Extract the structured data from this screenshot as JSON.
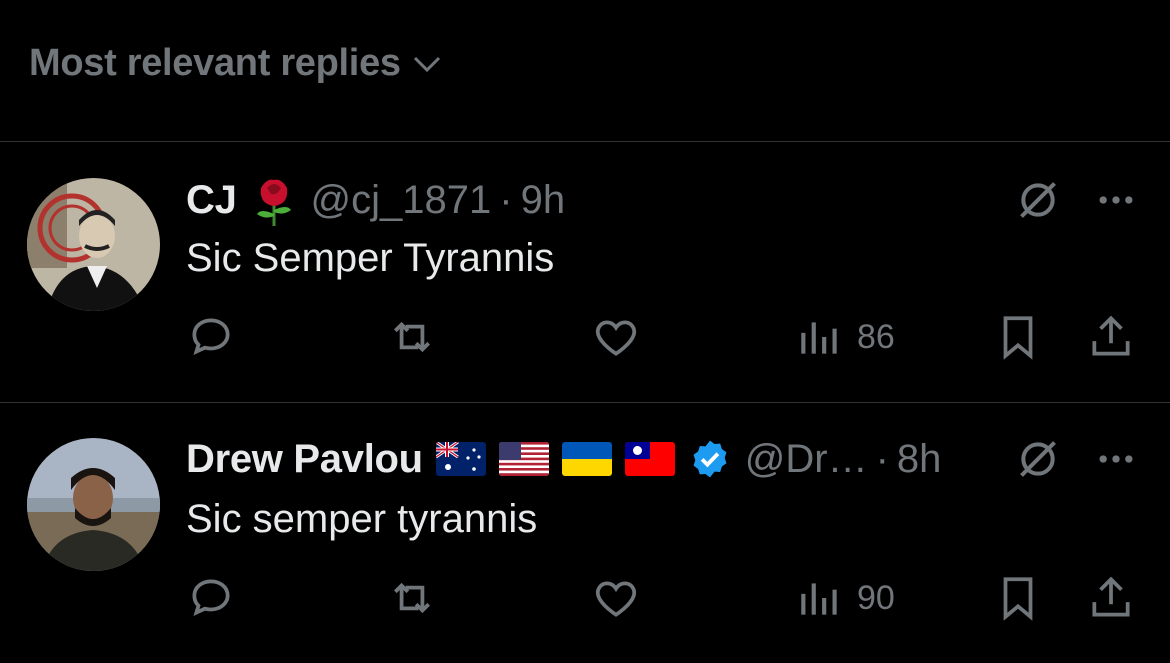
{
  "sort_header": {
    "label": "Most relevant replies",
    "icon": "chevron-down-icon"
  },
  "replies": [
    {
      "display_name": "CJ",
      "name_badges": [
        "rose-emoji"
      ],
      "handle": "@cj_1871",
      "separator": "·",
      "time": "9h",
      "text": "Sic Semper Tyrannis",
      "views": "86"
    },
    {
      "display_name": "Drew Pavlou",
      "name_badges": [
        "australia-flag",
        "usa-flag",
        "ukraine-flag",
        "taiwan-flag",
        "verified-badge"
      ],
      "handle": "@Dr…",
      "separator": "·",
      "time": "8h",
      "text": "Sic semper tyrannis",
      "views": "90"
    }
  ],
  "colors": {
    "background": "#000000",
    "text": "#e7e9ea",
    "muted": "#71767b",
    "divider": "#2f3336",
    "verified": "#1d9bf0"
  }
}
